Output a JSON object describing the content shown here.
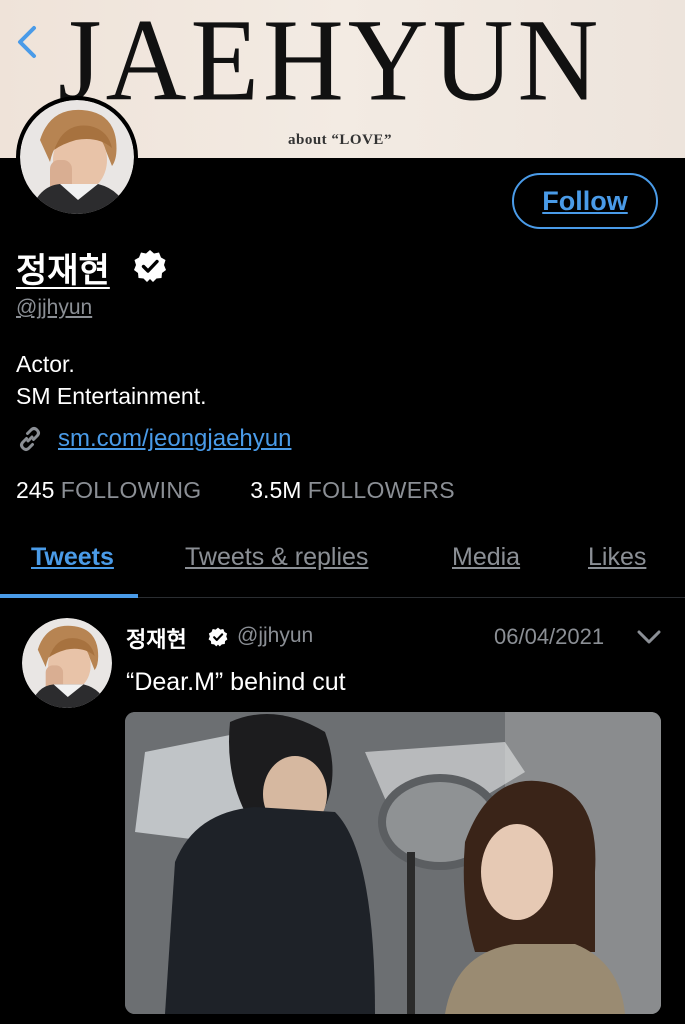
{
  "banner": {
    "title": "JAEHYUN",
    "subtitle": "about “LOVE”"
  },
  "profile": {
    "follow_label": "Follow",
    "name": "정재현",
    "handle": "@jjhyun",
    "bio_line1": "Actor.",
    "bio_line2": "SM Entertainment.",
    "link": "sm.com/jeongjaehyun",
    "following_count": "245",
    "following_label": "FOLLOWING",
    "followers_count": "3.5M",
    "followers_label": "FOLLOWERS"
  },
  "tabs": [
    {
      "label": "Tweets",
      "active": true
    },
    {
      "label": "Tweets & replies",
      "active": false
    },
    {
      "label": "Media",
      "active": false
    },
    {
      "label": "Likes",
      "active": false
    }
  ],
  "tweet": {
    "name": "정재현",
    "handle": "@jjhyun",
    "date": "06/04/2021",
    "text": "“Dear.M” behind cut"
  },
  "icons": {
    "back": "chevron-left-icon",
    "verified": "verified-badge-icon",
    "link": "link-icon",
    "more": "chevron-down-icon"
  },
  "colors": {
    "accent": "#4a9be8",
    "background": "#000000",
    "secondary_text": "#8b8f95"
  }
}
